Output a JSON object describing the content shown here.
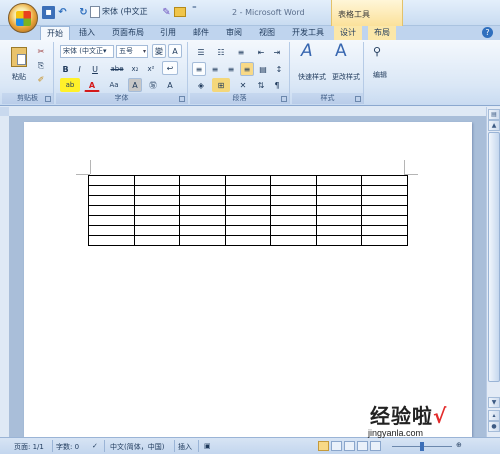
{
  "titlebar": {
    "qat_font": "宋体 (中文正",
    "doc_title": "2 - Microsoft Word",
    "context_tab_group": "表格工具"
  },
  "tabs": [
    {
      "label": "开始",
      "active": true
    },
    {
      "label": "插入"
    },
    {
      "label": "页面布局"
    },
    {
      "label": "引用"
    },
    {
      "label": "邮件"
    },
    {
      "label": "审阅"
    },
    {
      "label": "视图"
    },
    {
      "label": "开发工具"
    },
    {
      "label": "设计",
      "context": true
    },
    {
      "label": "布局",
      "context": true
    }
  ],
  "ribbon": {
    "clipboard": {
      "label": "剪贴板",
      "paste": "粘贴"
    },
    "font": {
      "label": "字体",
      "font_name": "宋体 (中文正▾",
      "font_size": "五号",
      "phonetic": "變",
      "bold": "B",
      "italic": "I",
      "underline": "U",
      "strike": "abe",
      "subscript": "x₂",
      "superscript": "x²",
      "change_case": "Aa",
      "clear_format": "A",
      "font_color": "A",
      "highlight": "ab",
      "char_shading": "A",
      "enclose": "㊢"
    },
    "paragraph": {
      "label": "段落"
    },
    "styles": {
      "label": "样式",
      "quick_styles": "快速样式",
      "change_styles": "更改样式"
    },
    "editing": {
      "label": "编辑"
    }
  },
  "table": {
    "rows": 7,
    "cols": 7
  },
  "statusbar": {
    "page": "页面: 1/1",
    "words": "字数: 0",
    "language": "中文(简体，中国)",
    "mode": "插入"
  },
  "watermark": {
    "text": "经验啦",
    "check": "√",
    "url": "jingyanla.com"
  }
}
